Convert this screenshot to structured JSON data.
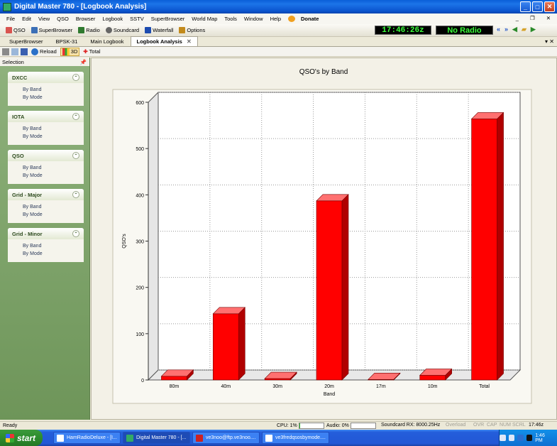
{
  "window": {
    "title": "Digital Master 780 - [Logbook Analysis]"
  },
  "menu": [
    "File",
    "Edit",
    "View",
    "QSO",
    "Browser",
    "Logbook",
    "SSTV",
    "SuperBrowser",
    "World Map",
    "Tools",
    "Window",
    "Help"
  ],
  "donate_label": "Donate",
  "toolbar": {
    "items": [
      {
        "label": "QSO",
        "icon": "qso-icon",
        "color": "#d9534f"
      },
      {
        "label": "SuperBrowser",
        "icon": "browser-icon",
        "color": "#3b6fb6"
      },
      {
        "label": "Radio",
        "icon": "radio-icon",
        "color": "#2f7a2f"
      },
      {
        "label": "Soundcard",
        "icon": "soundcard-icon",
        "color": "#666666"
      },
      {
        "label": "Waterfall",
        "icon": "waterfall-icon",
        "color": "#1c4bb0"
      },
      {
        "label": "Options",
        "icon": "options-icon",
        "color": "#c28a1c"
      }
    ],
    "clock": "17:46:26z",
    "radio_status": "No Radio"
  },
  "tabs": [
    {
      "label": "SuperBrowser",
      "active": false
    },
    {
      "label": "BPSK-31",
      "active": false
    },
    {
      "label": "Main Logbook",
      "active": false
    },
    {
      "label": "Logbook Analysis",
      "active": true
    }
  ],
  "subtoolbar": {
    "reload": "Reload",
    "threed": "3D",
    "total": "Total"
  },
  "selection": {
    "header": "Selection",
    "groups": [
      {
        "title": "DXCC",
        "items": [
          "By Band",
          "By Mode"
        ]
      },
      {
        "title": "IOTA",
        "items": [
          "By Band",
          "By Mode"
        ]
      },
      {
        "title": "QSO",
        "items": [
          "By Band",
          "By Mode"
        ]
      },
      {
        "title": "Grid - Major",
        "items": [
          "By Band",
          "By Mode"
        ]
      },
      {
        "title": "Grid - Minor",
        "items": [
          "By Band",
          "By Mode"
        ]
      }
    ]
  },
  "chart_data": {
    "type": "bar",
    "title": "QSO's by Band",
    "xlabel": "Band",
    "ylabel": "QSO's",
    "categories": [
      "80m",
      "40m",
      "30m",
      "20m",
      "17m",
      "10m",
      "Total"
    ],
    "values": [
      8,
      143,
      3,
      387,
      1,
      10,
      564
    ],
    "ylim": [
      0,
      600
    ],
    "yticks": [
      0,
      100,
      200,
      300,
      400,
      500,
      600
    ],
    "grid": true,
    "bar_color": "#ff0000",
    "style": "3D"
  },
  "status": {
    "ready": "Ready",
    "cpu": "CPU: 1%",
    "cpu_pct": 0.01,
    "audio": "Audio: 0%",
    "audio_pct": 0.0,
    "soundcard": "Soundcard RX: 8000.25Hz",
    "overload": "Overload",
    "keys": [
      "OVR",
      "CAP",
      "NUM",
      "SCRL"
    ],
    "time": "17:46z"
  },
  "taskbar": {
    "start": "start",
    "items": [
      {
        "label": "HamRadioDeluxe - [I...",
        "active": false
      },
      {
        "label": "Digital Master 780 - [...",
        "active": true
      },
      {
        "label": "ve3noo@ftp.ve3noo....",
        "active": false
      },
      {
        "label": "ve3fredqsosbymode....",
        "active": false
      }
    ],
    "clock": "1:46 PM"
  }
}
